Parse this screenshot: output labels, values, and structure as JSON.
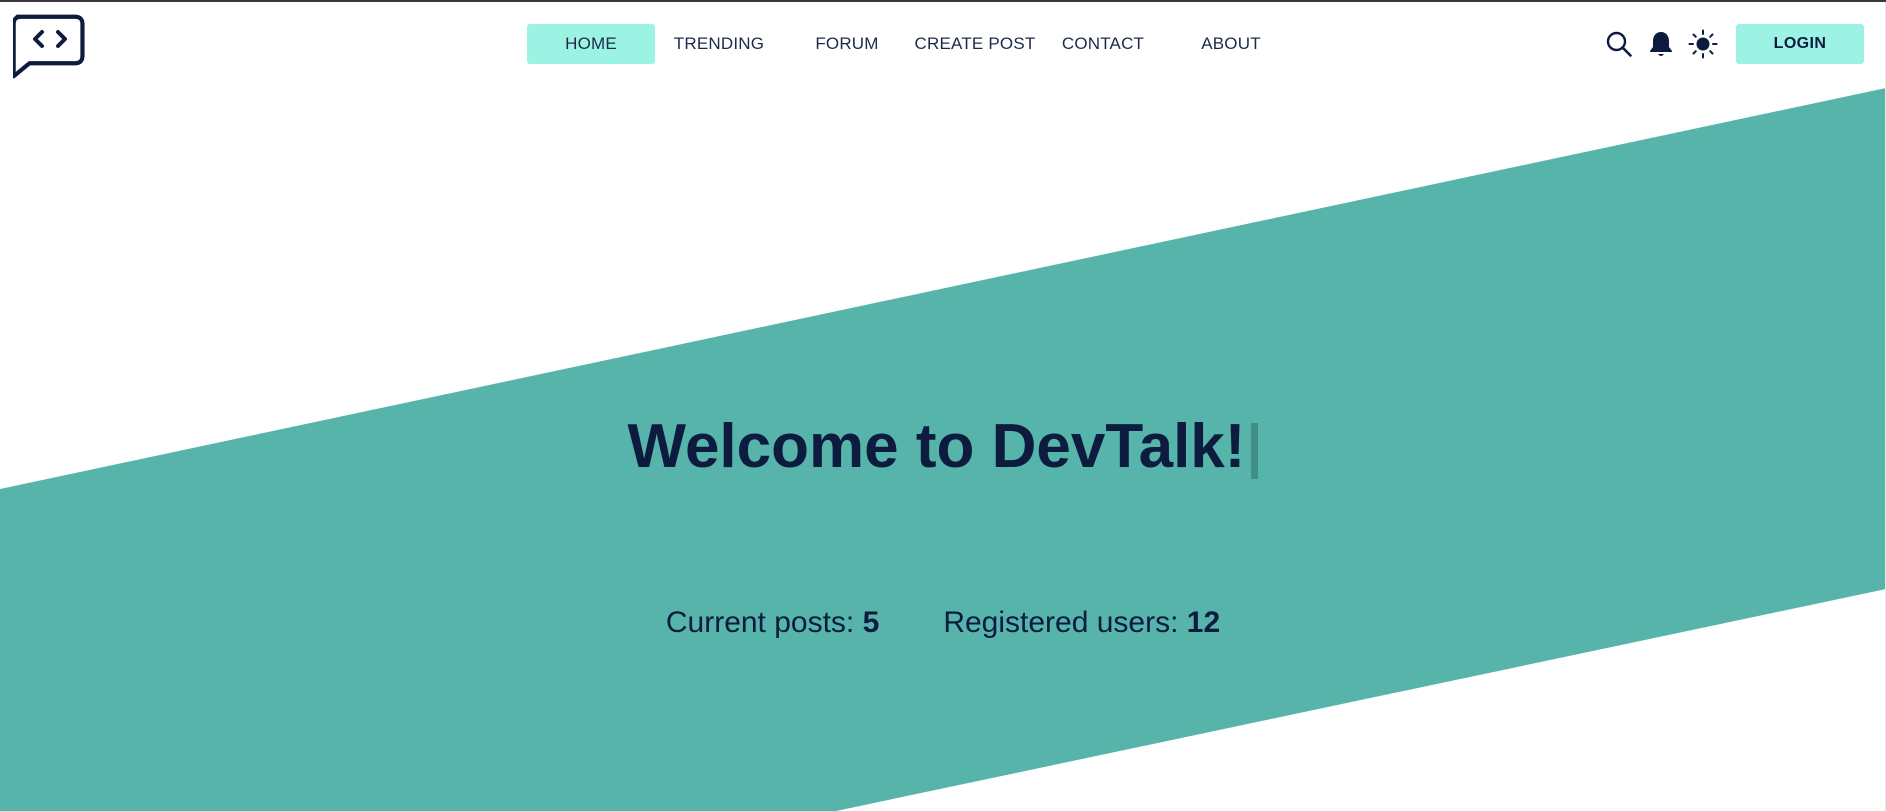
{
  "colors": {
    "band": "#56b4ab",
    "accent": "#9df3e3",
    "text": "#0d1b3e"
  },
  "logo": {
    "icon": "code-chat-bubble-icon"
  },
  "nav": {
    "items": [
      {
        "label": "HOME",
        "active": true
      },
      {
        "label": "TRENDING",
        "active": false
      },
      {
        "label": "FORUM",
        "active": false
      },
      {
        "label": "CREATE POST",
        "active": false
      },
      {
        "label": "CONTACT",
        "active": false
      },
      {
        "label": "ABOUT",
        "active": false
      }
    ]
  },
  "tools": {
    "search_icon": "search-icon",
    "notifications_icon": "bell-icon",
    "theme_icon": "sun-icon",
    "login_label": "LOGIN"
  },
  "hero": {
    "title": "Welcome to DevTalk!",
    "posts_label": "Current posts:",
    "posts_value": "5",
    "users_label": "Registered users:",
    "users_value": "12"
  }
}
